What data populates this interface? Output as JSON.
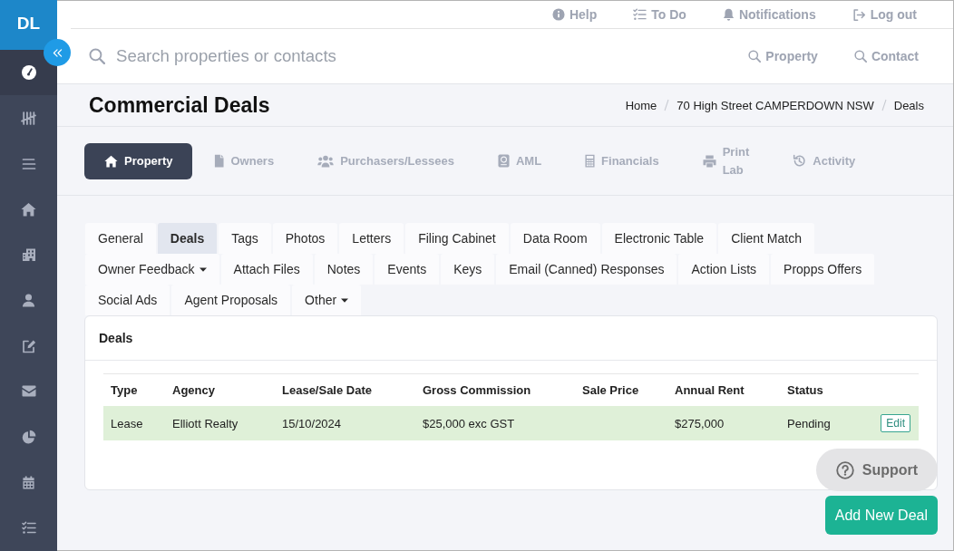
{
  "sidebar": {
    "logo": "DL",
    "items": [
      {
        "selected": true
      },
      {
        "selected": false
      },
      {
        "selected": false
      },
      {
        "selected": false
      },
      {
        "selected": false
      },
      {
        "selected": false
      },
      {
        "selected": false
      },
      {
        "selected": false
      },
      {
        "selected": false
      },
      {
        "selected": false
      },
      {
        "selected": false
      }
    ]
  },
  "top_links": [
    "Help",
    "To Do",
    "Notifications",
    "Log out"
  ],
  "search": {
    "placeholder": "Search properties or contacts",
    "shortcuts": [
      "Property",
      "Contact"
    ]
  },
  "header": {
    "title": "Commercial Deals",
    "breadcrumb": [
      "Home",
      "70 High Street CAMPERDOWN NSW",
      "Deals"
    ]
  },
  "main_tabs": [
    {
      "label": "Property",
      "selected": true
    },
    {
      "label": "Owners",
      "selected": false
    },
    {
      "label": "Purchasers/Lessees",
      "selected": false
    },
    {
      "label": "AML",
      "selected": false
    },
    {
      "label": "Financials",
      "selected": false
    },
    {
      "label": "Print Lab",
      "selected": false
    },
    {
      "label": "Activity",
      "selected": false
    }
  ],
  "sub_tab_rows": [
    [
      {
        "label": "General",
        "selected": false,
        "dropdown": false
      },
      {
        "label": "Deals",
        "selected": true,
        "dropdown": false
      },
      {
        "label": "Tags",
        "selected": false,
        "dropdown": false
      },
      {
        "label": "Photos",
        "selected": false,
        "dropdown": false
      },
      {
        "label": "Letters",
        "selected": false,
        "dropdown": false
      },
      {
        "label": "Filing Cabinet",
        "selected": false,
        "dropdown": false
      },
      {
        "label": "Data Room",
        "selected": false,
        "dropdown": false
      },
      {
        "label": "Electronic Table",
        "selected": false,
        "dropdown": false
      },
      {
        "label": "Client Match",
        "selected": false,
        "dropdown": false
      }
    ],
    [
      {
        "label": "Owner Feedback",
        "selected": false,
        "dropdown": true
      },
      {
        "label": "Attach Files",
        "selected": false,
        "dropdown": false
      },
      {
        "label": "Notes",
        "selected": false,
        "dropdown": false
      },
      {
        "label": "Events",
        "selected": false,
        "dropdown": false
      },
      {
        "label": "Keys",
        "selected": false,
        "dropdown": false
      },
      {
        "label": "Email (Canned) Responses",
        "selected": false,
        "dropdown": false
      },
      {
        "label": "Action Lists",
        "selected": false,
        "dropdown": false
      },
      {
        "label": "Propps Offers",
        "selected": false,
        "dropdown": false
      }
    ],
    [
      {
        "label": "Social Ads",
        "selected": false,
        "dropdown": false
      },
      {
        "label": "Agent Proposals",
        "selected": false,
        "dropdown": false
      },
      {
        "label": "Other",
        "selected": false,
        "dropdown": true
      }
    ]
  ],
  "deals_panel": {
    "title": "Deals",
    "table": {
      "columns": [
        "Type",
        "Agency",
        "Lease/Sale Date",
        "Gross Commission",
        "Sale Price",
        "Annual Rent",
        "Status"
      ],
      "rows": [
        {
          "type": "Lease",
          "agency": "Elliott Realty",
          "lease_sale_date": "15/10/2024",
          "gross_commission": "$25,000 exc GST",
          "annual_rent": "$275,000",
          "status": "Pending",
          "action": "Edit"
        }
      ]
    }
  },
  "support_button": "Support",
  "add_button": "Add New Deal"
}
